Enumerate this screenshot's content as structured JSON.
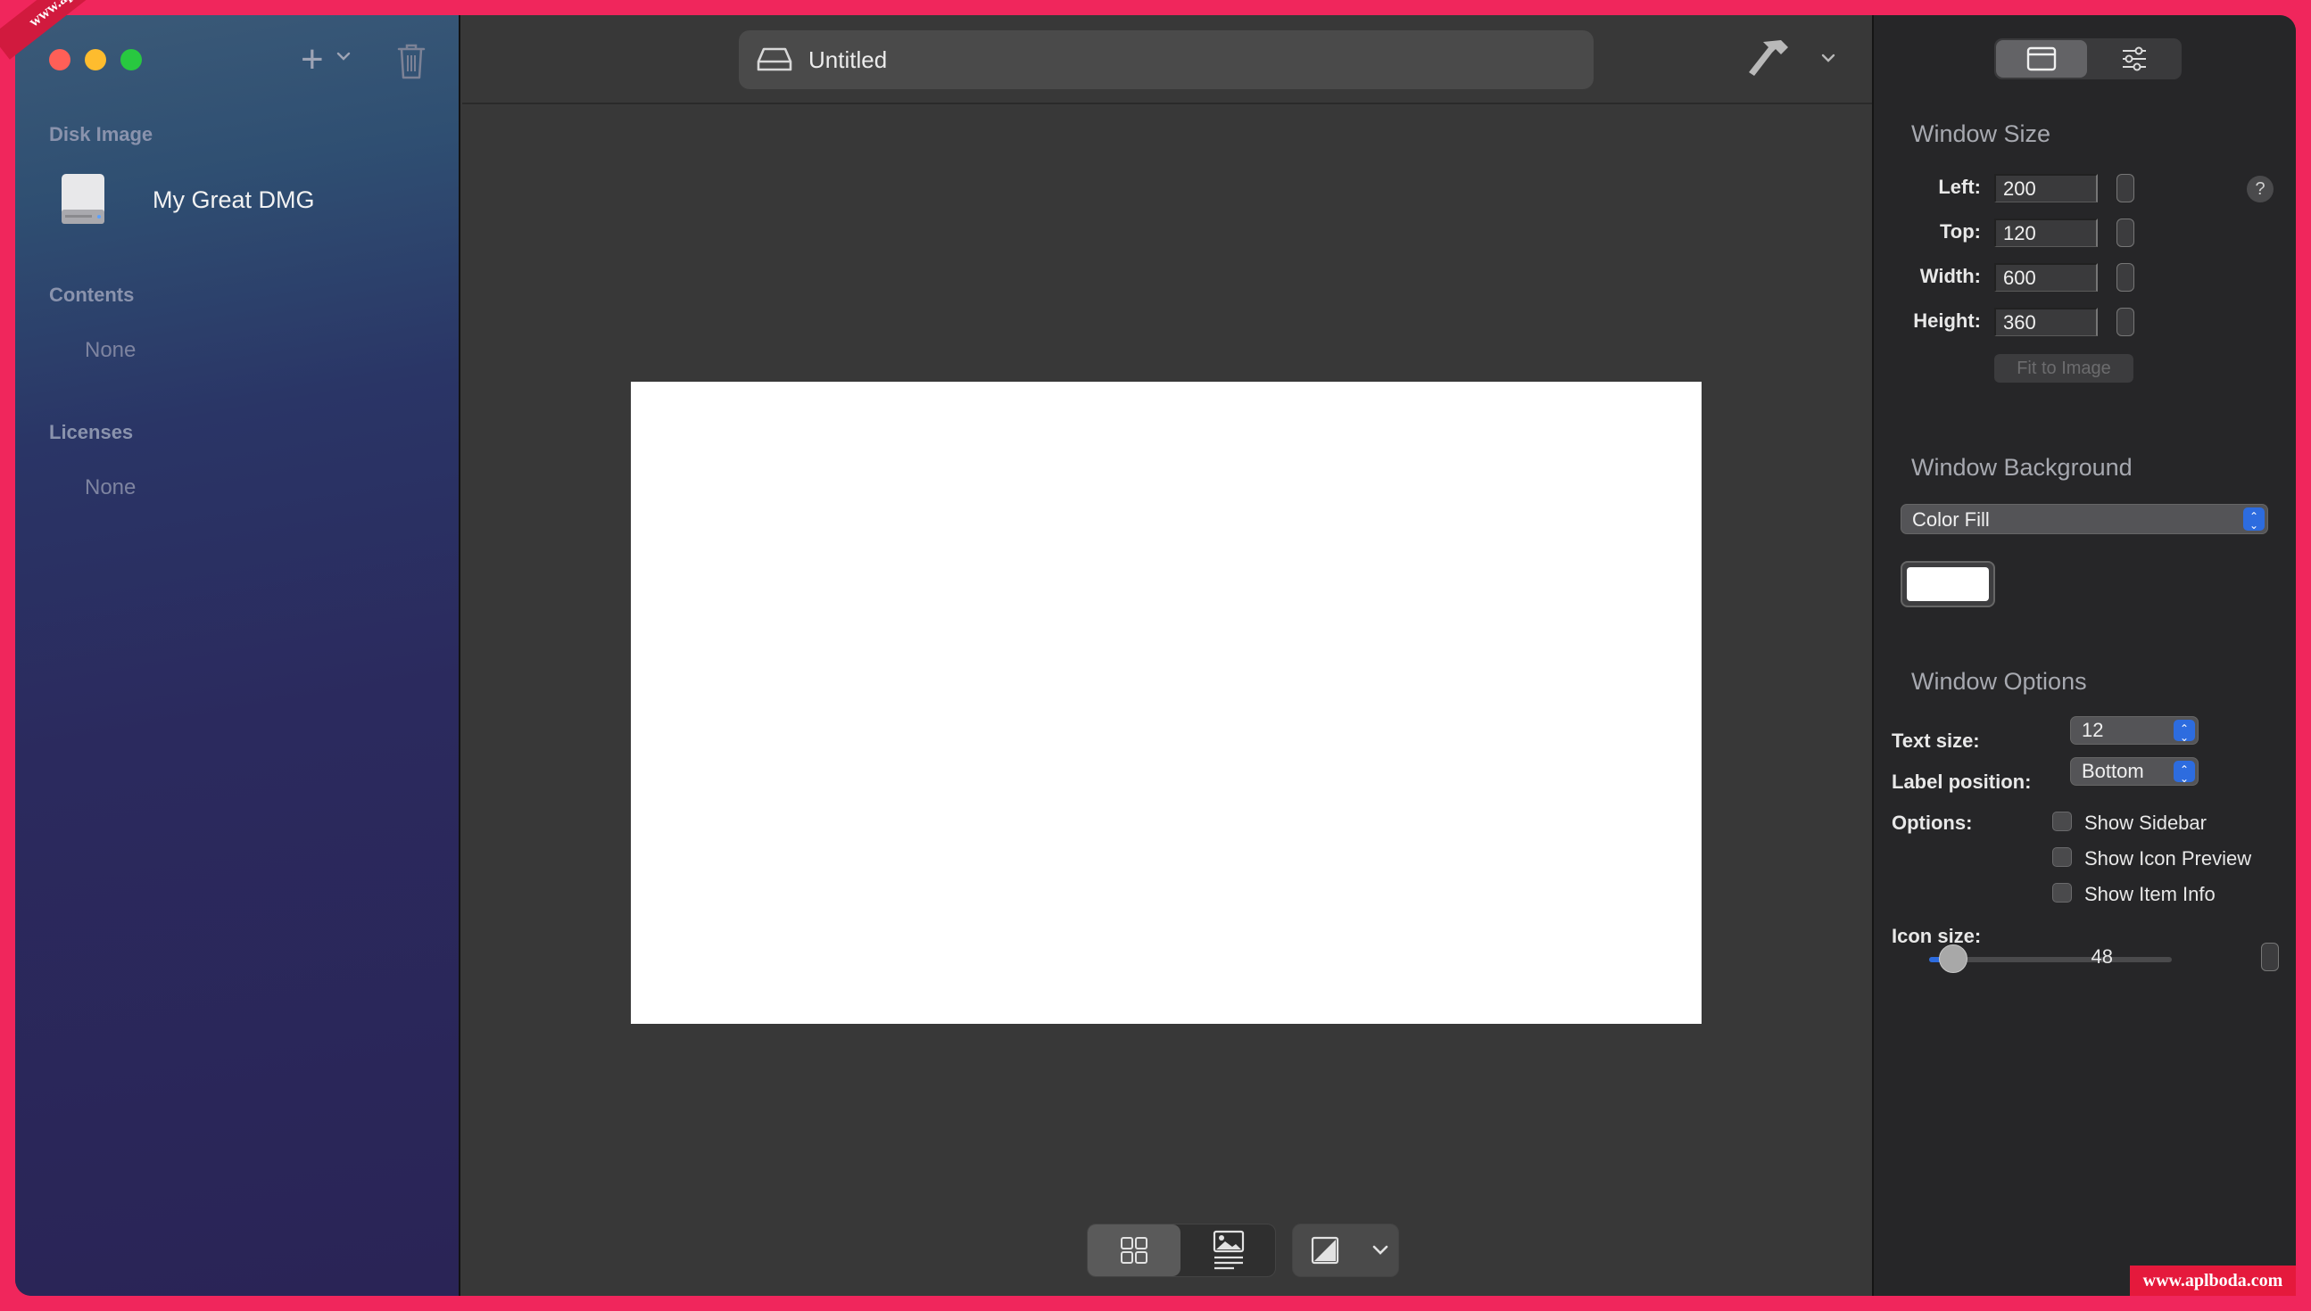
{
  "sidebar": {
    "sections": {
      "disk_image": "Disk Image",
      "contents": "Contents",
      "licenses": "Licenses"
    },
    "disk_name": "My Great DMG",
    "contents_empty": "None",
    "licenses_empty": "None"
  },
  "toolbar": {
    "document_title": "Untitled"
  },
  "inspector": {
    "window_size": {
      "heading": "Window Size",
      "left_label": "Left:",
      "left_value": "200",
      "top_label": "Top:",
      "top_value": "120",
      "width_label": "Width:",
      "width_value": "600",
      "height_label": "Height:",
      "height_value": "360",
      "fit_button": "Fit to Image",
      "help": "?"
    },
    "window_background": {
      "heading": "Window Background",
      "type": "Color Fill",
      "color": "#ffffff"
    },
    "window_options": {
      "heading": "Window Options",
      "text_size_label": "Text size:",
      "text_size_value": "12",
      "label_position_label": "Label position:",
      "label_position_value": "Bottom",
      "options_label": "Options:",
      "show_sidebar": "Show Sidebar",
      "show_icon_preview": "Show Icon Preview",
      "show_item_info": "Show Item Info",
      "icon_size_label": "Icon size:",
      "icon_size_value": "48",
      "icon_size_fraction": 0.1
    }
  },
  "watermark": {
    "corner": "www.aplboda.com",
    "bottom_right": "www.aplboda.com"
  },
  "colors": {
    "accent": "#2d6cdf",
    "frame": "#f0265c"
  }
}
